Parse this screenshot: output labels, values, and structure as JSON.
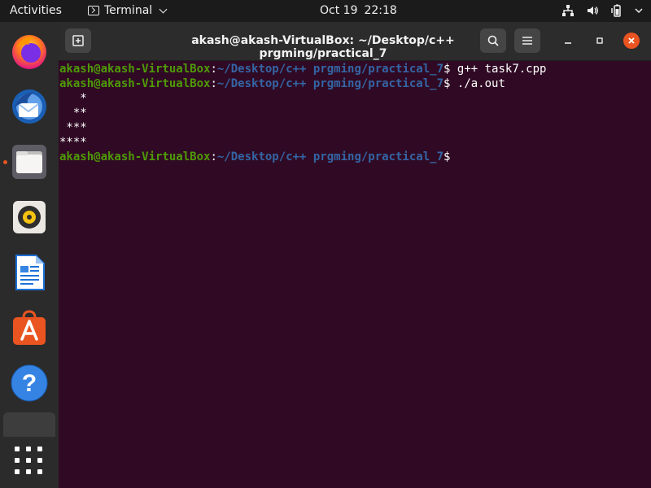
{
  "topbar": {
    "activities": "Activities",
    "app_name": "Terminal",
    "date": "Oct 19",
    "time": "22:18"
  },
  "dock": {
    "items": [
      "Firefox",
      "Thunderbird Mail",
      "Files",
      "Rhythmbox",
      "LibreOffice Writer",
      "Ubuntu Software",
      "Help"
    ],
    "show_apps": "Show Applications"
  },
  "terminal": {
    "title": "akash@akash-VirtualBox: ~/Desktop/c++ prgming/practical_7",
    "prompt_user": "akash@akash-VirtualBox",
    "prompt_path": "~/Desktop/c++ prgming/practical_7",
    "lines": {
      "cmd1": " g++ task7.cpp",
      "cmd2": " ./a.out",
      "out1": "   *",
      "out2": "  **",
      "out3": " ***",
      "out4": "****"
    }
  },
  "colors": {
    "terminal_bg": "#300a24",
    "prompt_user": "#4e9a06",
    "prompt_path": "#3465a4",
    "close_button": "#e95420"
  }
}
